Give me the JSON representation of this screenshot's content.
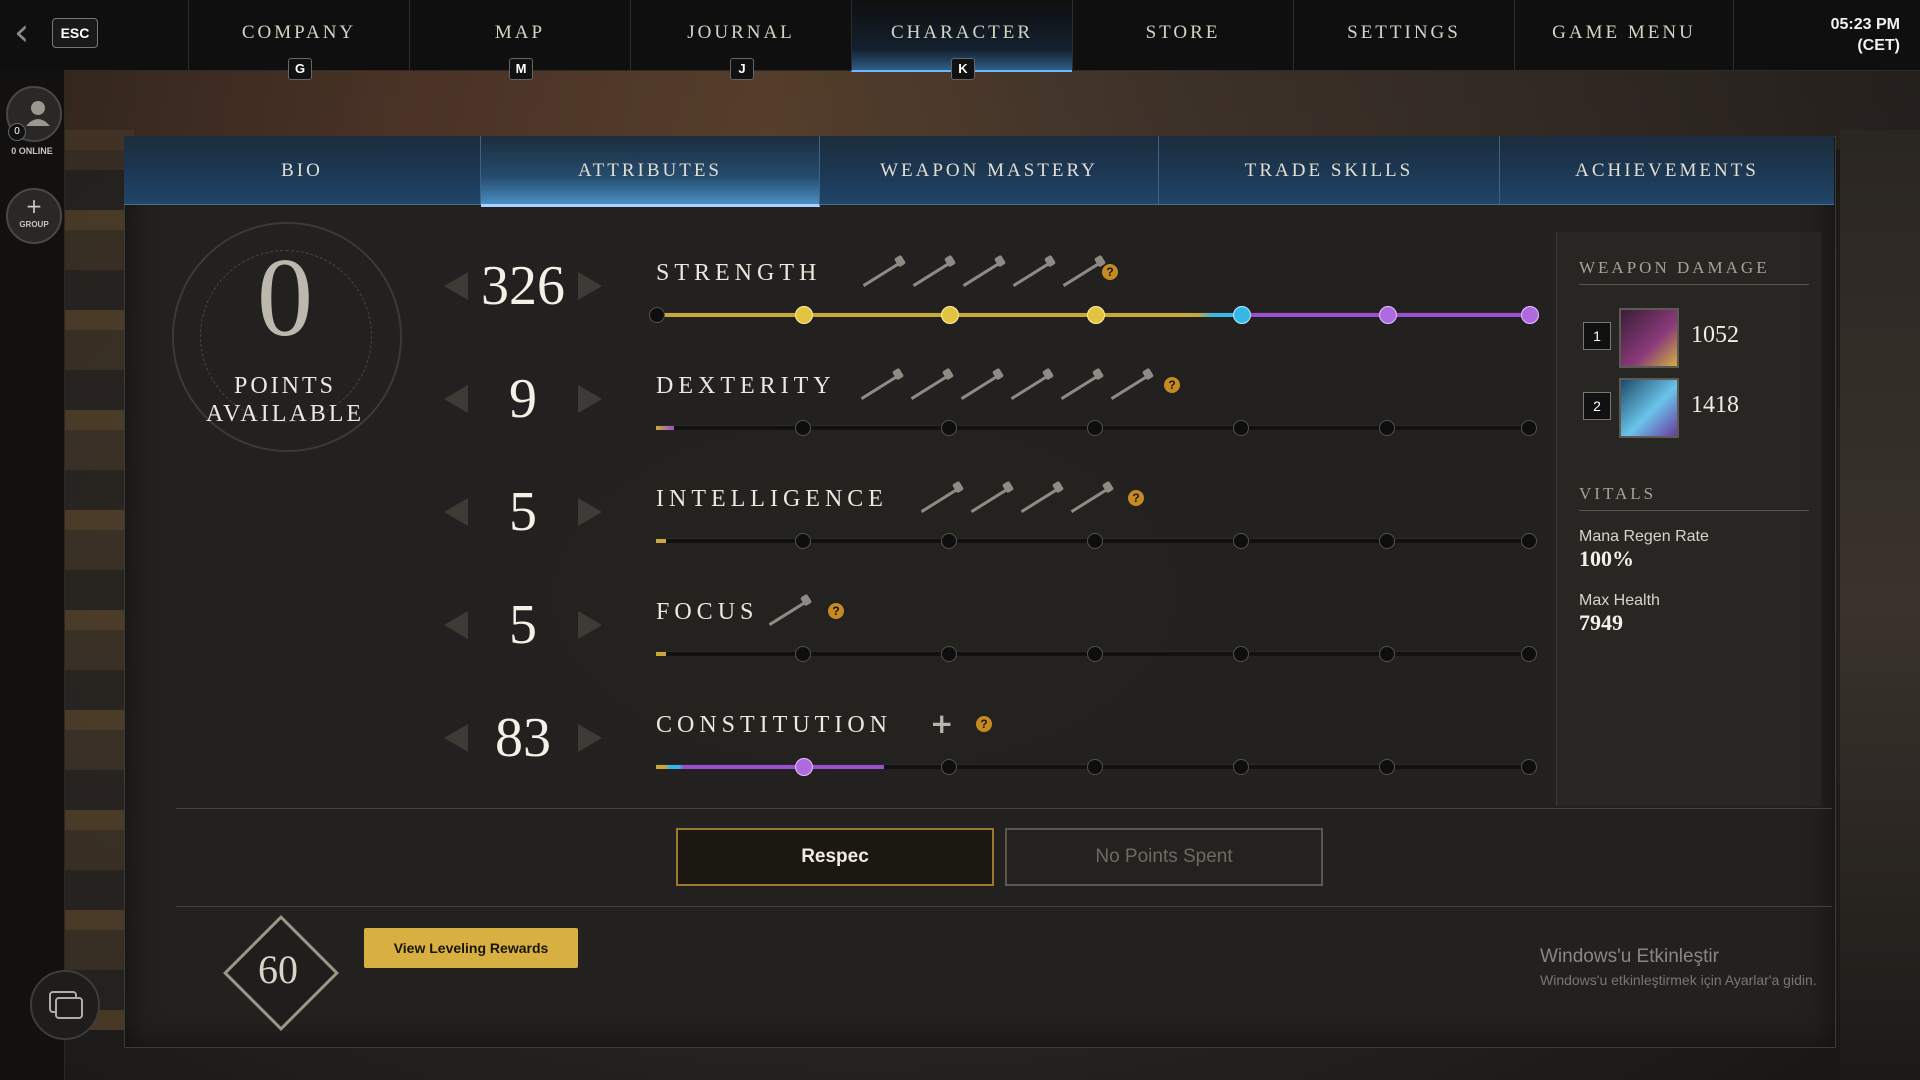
{
  "nav": {
    "esc_label": "ESC",
    "tabs": [
      {
        "label": "COMPANY",
        "key": "G"
      },
      {
        "label": "MAP",
        "key": "M"
      },
      {
        "label": "JOURNAL",
        "key": "J"
      },
      {
        "label": "CHARACTER",
        "key": "K"
      },
      {
        "label": "STORE",
        "key": ""
      },
      {
        "label": "SETTINGS",
        "key": ""
      },
      {
        "label": "GAME MENU",
        "key": ""
      }
    ],
    "active_tab": "CHARACTER",
    "clock_time": "05:23 PM",
    "clock_zone": "(CET)"
  },
  "sidebar": {
    "online_count": "0",
    "online_label": "0 ONLINE",
    "group_label": "GROUP"
  },
  "subtabs": {
    "items": [
      "BIO",
      "ATTRIBUTES",
      "WEAPON MASTERY",
      "TRADE SKILLS",
      "ACHIEVEMENTS"
    ],
    "active": "ATTRIBUTES"
  },
  "points": {
    "value": "0",
    "label_line1": "POINTS",
    "label_line2": "AVAILABLE"
  },
  "attributes": [
    {
      "name": "STRENGTH",
      "value": "326",
      "fill_fraction": 1.0,
      "weapon_icons": 5,
      "has_help": true
    },
    {
      "name": "DEXTERITY",
      "value": "9",
      "fill_fraction": 0.02,
      "weapon_icons": 6,
      "has_help": true
    },
    {
      "name": "INTELLIGENCE",
      "value": "5",
      "fill_fraction": 0.01,
      "weapon_icons": 4,
      "has_help": true
    },
    {
      "name": "FOCUS",
      "value": "5",
      "fill_fraction": 0.01,
      "weapon_icons": 1,
      "has_help": true
    },
    {
      "name": "CONSTITUTION",
      "value": "83",
      "fill_fraction": 0.26,
      "weapon_icons": 0,
      "has_help": true,
      "has_plus": true
    }
  ],
  "weapon_damage": {
    "title": "WEAPON DAMAGE",
    "slots": [
      {
        "slot": "1",
        "value": "1052",
        "icon": "war-hammer-icon"
      },
      {
        "slot": "2",
        "value": "1418",
        "icon": "great-axe-icon"
      }
    ]
  },
  "vitals": {
    "title": "VITALS",
    "items": [
      {
        "label": "Mana Regen Rate",
        "value": "100%"
      },
      {
        "label": "Max Health",
        "value": "7949"
      }
    ]
  },
  "buttons": {
    "respec": "Respec",
    "no_points": "No Points Spent",
    "view_rewards": "View Leveling Rewards"
  },
  "level": "60",
  "watermark": {
    "line1": "Windows'u Etkinleştir",
    "line2": "Windows'u etkinleştirmek için Ayarlar'a gidin."
  },
  "colors": {
    "strength_track": "#c9a83a",
    "strength_node": "#e2c440",
    "accent_blue": "#37b6e8",
    "purple": "#9a4fd0"
  }
}
